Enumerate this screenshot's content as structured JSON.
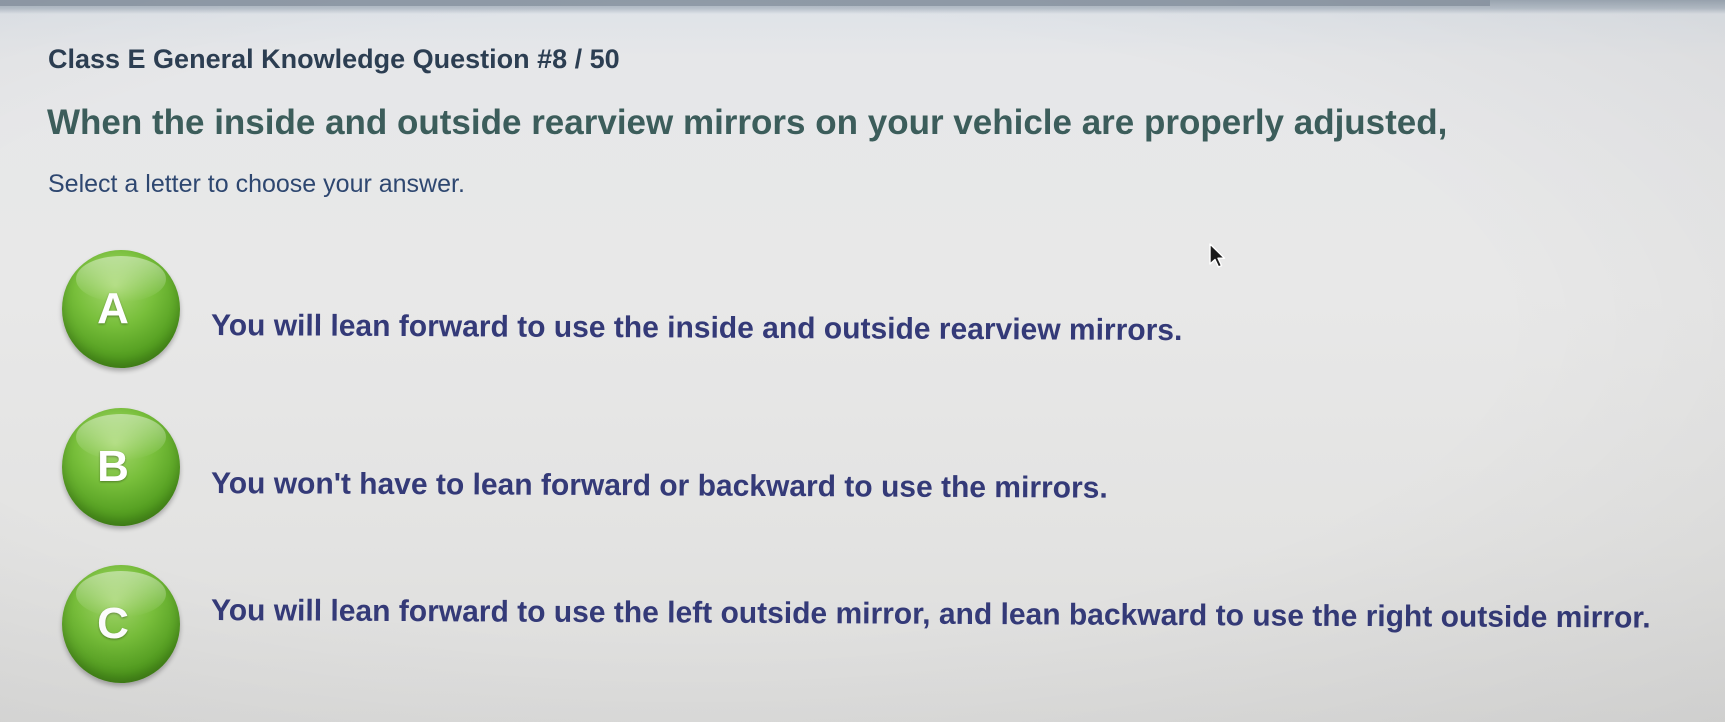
{
  "quiz": {
    "header": "Class E General Knowledge Question #8 / 50",
    "question": "When the inside and outside rearview mirrors on your vehicle are properly adjusted,",
    "instruction": "Select a letter to choose your answer."
  },
  "answers": [
    {
      "letter": "A",
      "text": "You will lean forward to use the inside and outside rearview mirrors."
    },
    {
      "letter": "B",
      "text": "You won't have to lean forward or backward to use the mirrors."
    },
    {
      "letter": "C",
      "text": "You will lean forward to use the left outside mirror, and lean backward to use the right outside mirror."
    }
  ],
  "colors": {
    "button_green": "#5ba823",
    "question_text": "#3c5d5b",
    "answer_text": "#343a78",
    "instruction_text": "#2e4770"
  },
  "icons": {
    "cursor": "mouse-pointer-icon"
  }
}
